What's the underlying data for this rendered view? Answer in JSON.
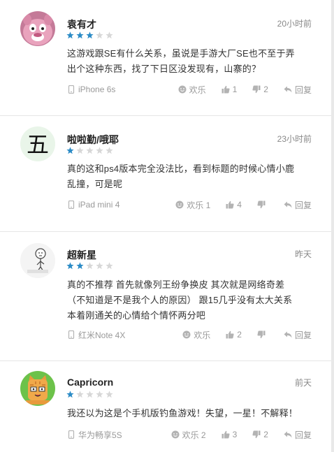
{
  "colors": {
    "star_on": "#2b8bc6",
    "star_off": "#d7d7d7",
    "icon": "#b3b3b3"
  },
  "reviews": [
    {
      "user": "袁有才",
      "time": "20小时前",
      "rating": 3,
      "text_lines": [
        "这游戏跟SE有什么关系，虽说是手游大厂SE也不至于弄",
        "出个这种东西，找了下日区没发现有，山寨的？"
      ],
      "device": "iPhone 6s",
      "happy_label": "欢乐",
      "like_count": "1",
      "dislike_count": "2",
      "reply_label": "回复",
      "avatar_icon": "pink-pig-avatar"
    },
    {
      "user": "啦啦勤/哦耶",
      "time": "23小时前",
      "rating": 1,
      "text_lines": [
        "真的这和ps4版本完全没法比，看到标题的时候心情小鹿",
        "乱撞，可是呢"
      ],
      "device": "iPad mini 4",
      "happy_label": "欢乐 1",
      "like_count": "4",
      "dislike_count": "",
      "reply_label": "回复",
      "avatar_icon": "character-wu-avatar",
      "avatar_char": "五"
    },
    {
      "user": "超新星",
      "time": "昨天",
      "rating": 2,
      "text_lines": [
        "真的不推荐 首先就像列王纷争换皮 其次就是网络奇差",
        "（不知道是不是我个人的原因） 跟15几乎没有太大关系",
        "本着刚通关的心情给个情怀两分吧"
      ],
      "device": "红米Note 4X",
      "happy_label": "欢乐",
      "like_count": "2",
      "dislike_count": "",
      "reply_label": "回复",
      "avatar_icon": "sketch-figure-avatar"
    },
    {
      "user": "Capricorn",
      "time": "前天",
      "rating": 1,
      "text_lines": [
        "我还以为这是个手机版钓鱼游戏！失望，一星！不解释！"
      ],
      "device": "华为畅享5S",
      "happy_label": "欢乐 2",
      "like_count": "3",
      "dislike_count": "2",
      "reply_label": "回复",
      "avatar_icon": "cartoon-cat-avatar"
    }
  ]
}
